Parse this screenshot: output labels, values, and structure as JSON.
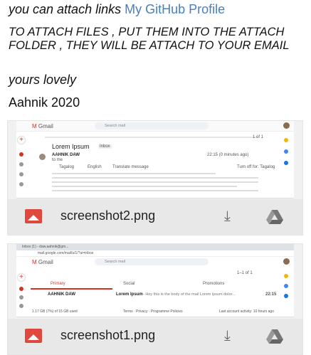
{
  "intro": {
    "prefix": "you can attach links ",
    "link_text": "My GitHub Profile"
  },
  "instructions": "TO ATTACH FILES , PUT THEM INTO THE ATTACH FOLDER , THEY WILL BE ATTACH TO YOUR EMAIL",
  "closing": "yours lovely",
  "signature": "Aahnik 2020",
  "attachments": [
    {
      "filename": "screenshot2.png",
      "preview": {
        "app": "Gmail",
        "search_placeholder": "Search mail",
        "subject": "Lorem Ipsum",
        "badge": "Inbox",
        "sender": "AAHNIK DAW",
        "recipient": "to me",
        "time": "22:15 (0 minutes ago)",
        "translate_from": "Tagalog",
        "translate_to": "English",
        "translate_msg": "Translate message",
        "translate_off": "Turn off for: Tagalog",
        "counter": "1 of 1"
      }
    },
    {
      "filename": "screenshot1.png",
      "preview": {
        "tab_title": "Inbox (1) - daw.aahnik@gm...",
        "url": "mail.google.com/mail/u/1/?ui=inbox",
        "app": "Gmail",
        "search_placeholder": "Search mail",
        "tabs": [
          "Primary",
          "Social",
          "Promotions"
        ],
        "counter": "1–1 of 1",
        "row": {
          "sender": "AAHNIK DAW",
          "subject": "Lorem Ipsum",
          "snippet": "- Hey this is the body of the mail Lorem ipsum dolor...",
          "time": "22:15"
        },
        "storage": "1.17 GB (7%) of 15 GB used",
        "footer_links": "Terms · Privacy · Programme Policies",
        "activity": "Last account activity: 10 hours ago"
      }
    }
  ],
  "colors": {
    "link": "#4a7fc0",
    "gmail_red": "#d93025",
    "image_icon": "#e0483e"
  },
  "icons": [
    "image-file-icon",
    "download-icon",
    "google-drive-icon"
  ]
}
